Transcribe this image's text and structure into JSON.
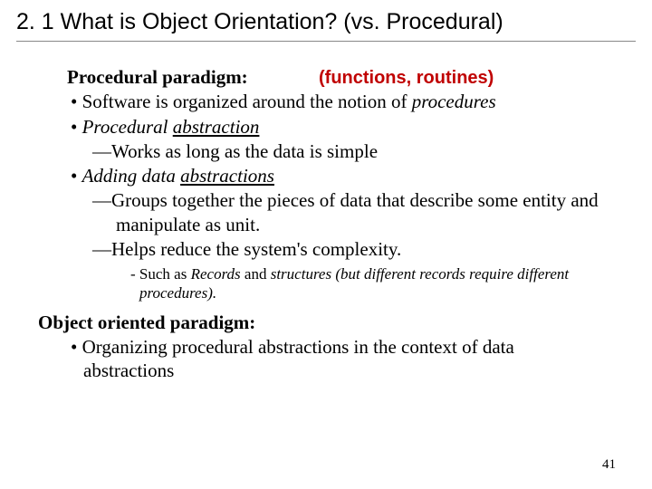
{
  "title": "2. 1 What is Object Orientation? (vs. Procedural)",
  "proc": {
    "heading": "Procedural paradigm:",
    "annotation": "(functions, routines)",
    "b1_pre": "Software is organized around the notion of ",
    "b1_em": "procedures",
    "b2_em1": "Procedural ",
    "b2_em2": "abstraction",
    "b2_d1": "Works as long as the data is simple",
    "b3_em1": "Adding data ",
    "b3_em2": "abstractions",
    "b3_d1": "Groups together the pieces of data that describe some entity and manipulate as unit.",
    "b3_d2": "Helps reduce the system's complexity.",
    "sub_pre": "Such as ",
    "sub_rec": "Records",
    "sub_mid": " and ",
    "sub_str": "structures",
    "sub_rest": " (but different records require different procedures)."
  },
  "oo": {
    "heading": "Object oriented paradigm:",
    "b1": "Organizing procedural abstractions in the context of data abstractions"
  },
  "page": "41"
}
